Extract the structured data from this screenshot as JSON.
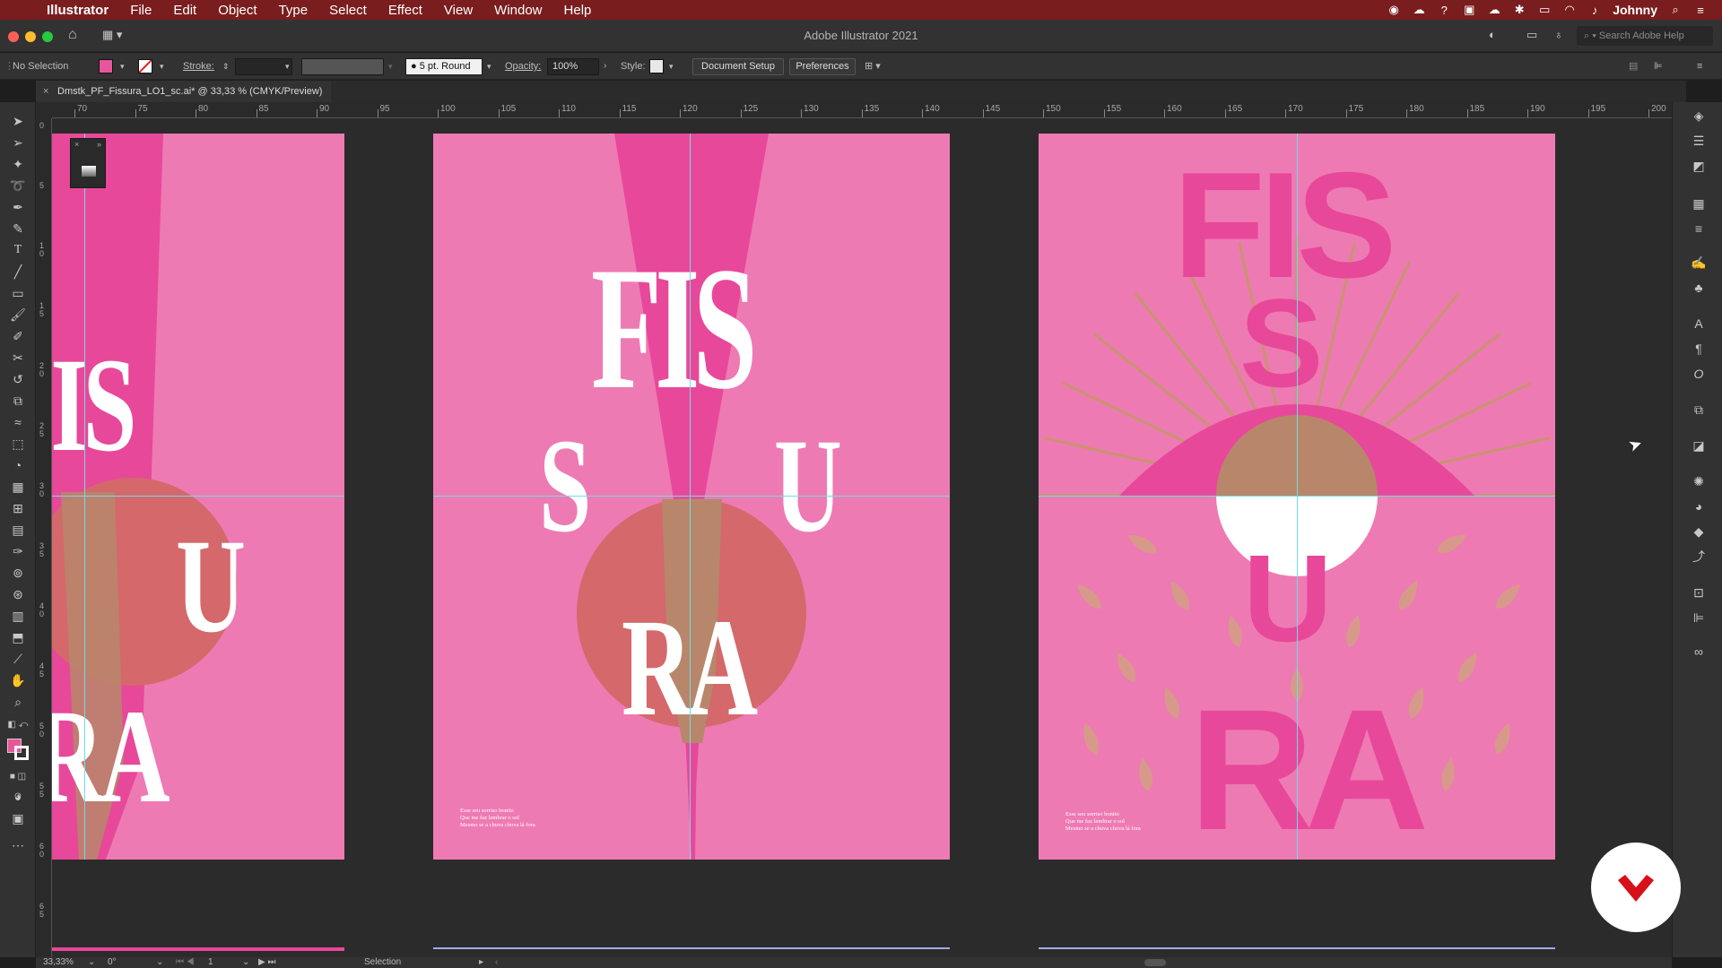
{
  "menubar": {
    "app_name": "Illustrator",
    "items": [
      "File",
      "Edit",
      "Object",
      "Type",
      "Select",
      "Effect",
      "View",
      "Window",
      "Help"
    ],
    "user": "Johnny"
  },
  "window": {
    "title": "Adobe Illustrator 2021",
    "search_placeholder": "Search Adobe Help"
  },
  "control_bar": {
    "selection_label": "No Selection",
    "stroke_label": "Stroke:",
    "brush_label": "5 pt. Round",
    "opacity_label": "Opacity:",
    "opacity_value": "100%",
    "style_label": "Style:",
    "document_setup": "Document Setup",
    "preferences": "Preferences",
    "fill_color": "#e8559a"
  },
  "document_tab": {
    "title": "Dmstk_PF_Fissura_LO1_sc.ai* @ 33,33 % (CMYK/Preview)"
  },
  "ruler": {
    "horizontal_ticks": [
      "70",
      "75",
      "80",
      "85",
      "90",
      "95",
      "100",
      "105",
      "110",
      "115",
      "120",
      "125",
      "130",
      "135",
      "140",
      "145",
      "150",
      "155",
      "160",
      "165",
      "170",
      "175",
      "180",
      "185",
      "190",
      "195",
      "200"
    ],
    "vertical_ticks": [
      "0",
      "5",
      "1 0",
      "1 5",
      "2 0",
      "2 5",
      "3 0",
      "3 5",
      "4 0",
      "4 5",
      "5 0",
      "5 5",
      "6 0",
      "6 5"
    ]
  },
  "artboards": {
    "poster1": {
      "words": [
        "FIS",
        "U",
        "RA"
      ]
    },
    "poster2": {
      "words": [
        "FIS",
        "S",
        "U",
        "RA"
      ],
      "small_text": [
        "Esse seu sorriso bonito",
        "Que me faz lembrar o sol",
        "Mesmo se a chuva chova lá fora"
      ]
    },
    "poster3": {
      "words": [
        "FIS",
        "S",
        "U",
        "RA"
      ],
      "small_text": [
        "Esse seu sorriso bonito",
        "Que me faz lembrar o sol",
        "Mesmo se a chuva chova lá fora"
      ]
    }
  },
  "colors": {
    "menubar": "#7a1d1e",
    "poster_pink": "#ee7ab3",
    "dark_pink": "#e8489a",
    "sun_tan": "#b8876b",
    "guide": "#6fdde8"
  },
  "status_bar": {
    "zoom": "33,33%",
    "rotation": "0°",
    "artboard_number": "1",
    "tool": "Selection"
  }
}
